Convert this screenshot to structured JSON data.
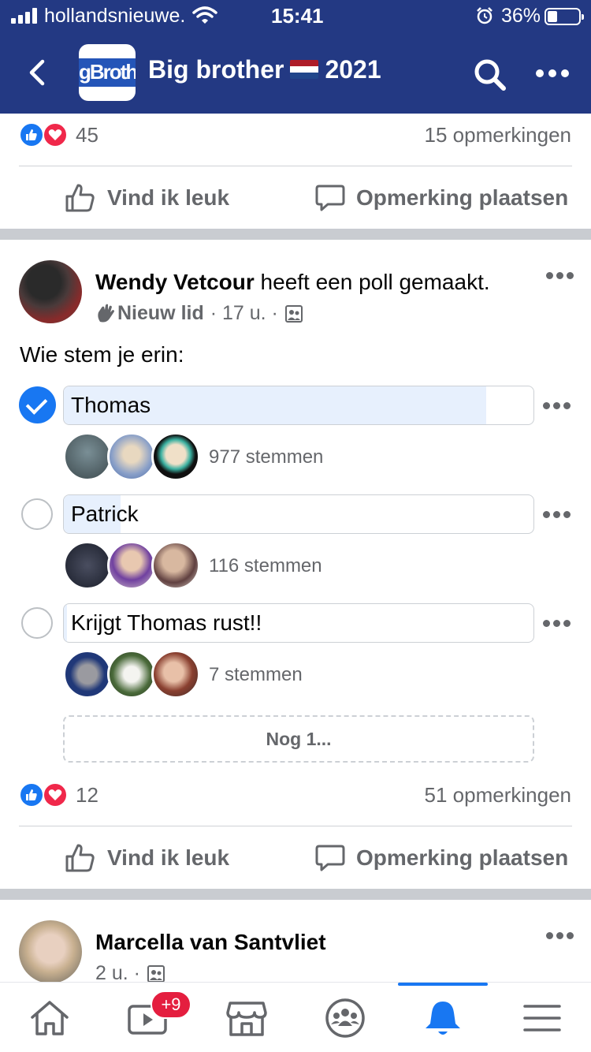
{
  "status_bar": {
    "carrier": "hollandsnieuwe.",
    "time": "15:41",
    "battery": "36%"
  },
  "header": {
    "logo_text": "gBroth",
    "group_name_part1": "Big brother",
    "group_name_part2": "2021",
    "icons": [
      "back-icon",
      "search-icon",
      "more-icon"
    ]
  },
  "prev_post": {
    "reaction_count": "45",
    "comments": "15 opmerkingen",
    "like_label": "Vind ik leuk",
    "comment_label": "Opmerking plaatsen"
  },
  "poll_post": {
    "author": "Wendy Vetcour",
    "action": "heeft een poll gemaakt.",
    "badge": "Nieuw lid",
    "time": "· 17 u. ·",
    "text": "Wie stem je erin:",
    "options": [
      {
        "label": "Thomas",
        "votes": "977 stemmen",
        "share": 0.9,
        "selected": true
      },
      {
        "label": "Patrick",
        "votes": "116 stemmen",
        "share": 0.12,
        "selected": false
      },
      {
        "label": "Krijgt Thomas rust!!",
        "votes": "7 stemmen",
        "share": 0.007,
        "selected": false
      }
    ],
    "more_options": "Nog 1...",
    "reaction_count": "12",
    "comments": "51 opmerkingen",
    "like_label": "Vind ik leuk",
    "comment_label": "Opmerking plaatsen"
  },
  "next_post": {
    "author": "Marcella van Santvliet",
    "time": "2 u. ·"
  },
  "bottom_nav": {
    "items": [
      "home-icon",
      "watch-icon",
      "marketplace-icon",
      "groups-icon",
      "notifications-icon",
      "menu-icon"
    ],
    "active": "notifications-icon",
    "watch_badge": "+9"
  },
  "colors": {
    "header_bg": "#233983",
    "accent": "#1877f2",
    "love": "#f0284a",
    "badge": "#e41e3f",
    "vote_bar": "#e7f0fd"
  }
}
